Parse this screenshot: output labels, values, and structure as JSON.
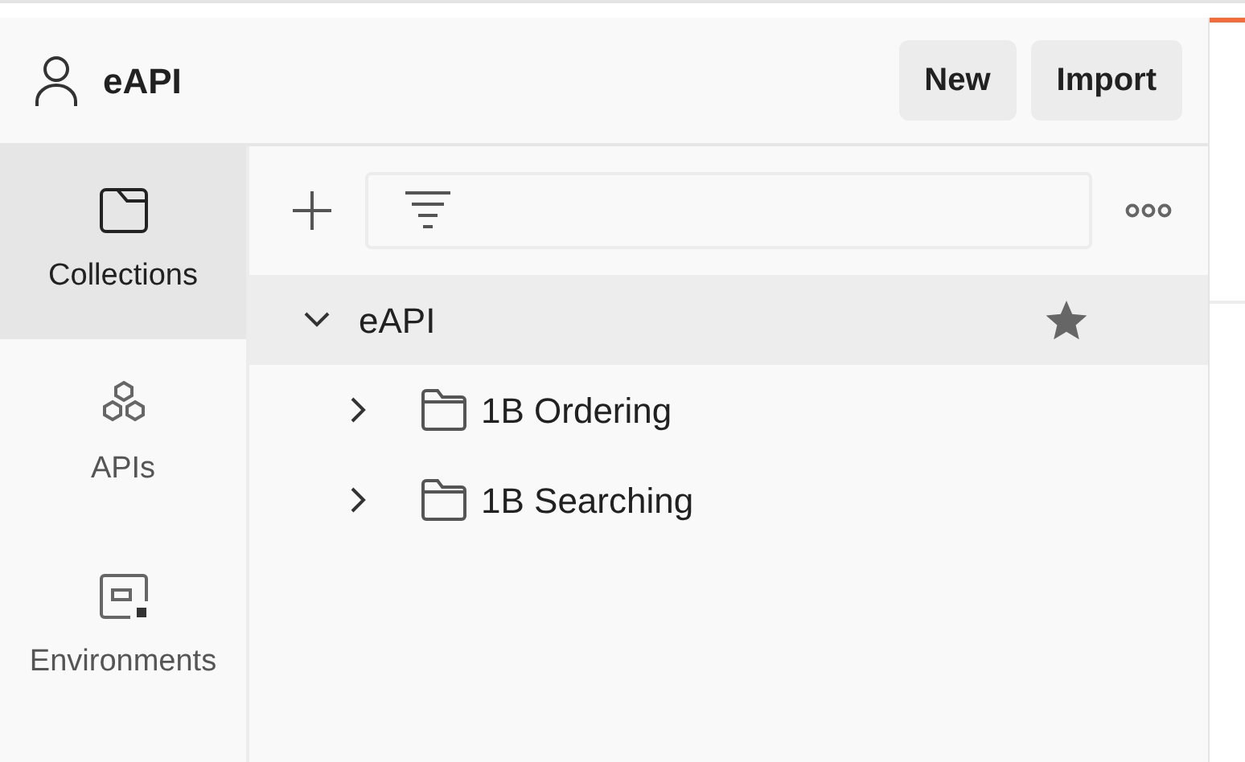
{
  "workspace": {
    "name": "eAPI"
  },
  "header_buttons": [
    "New",
    "Import"
  ],
  "sidebar": {
    "items": [
      {
        "label": "Collections",
        "kind": "collections",
        "selected": true
      },
      {
        "label": "APIs",
        "kind": "apis",
        "selected": false
      },
      {
        "label": "Environments",
        "kind": "environments",
        "selected": false
      }
    ]
  },
  "tree": [
    {
      "label": "eAPI",
      "expanded": true,
      "starred": true,
      "children": [
        {
          "label": "1B Ordering",
          "expanded": false
        },
        {
          "label": "1B Searching",
          "expanded": false
        }
      ]
    }
  ]
}
